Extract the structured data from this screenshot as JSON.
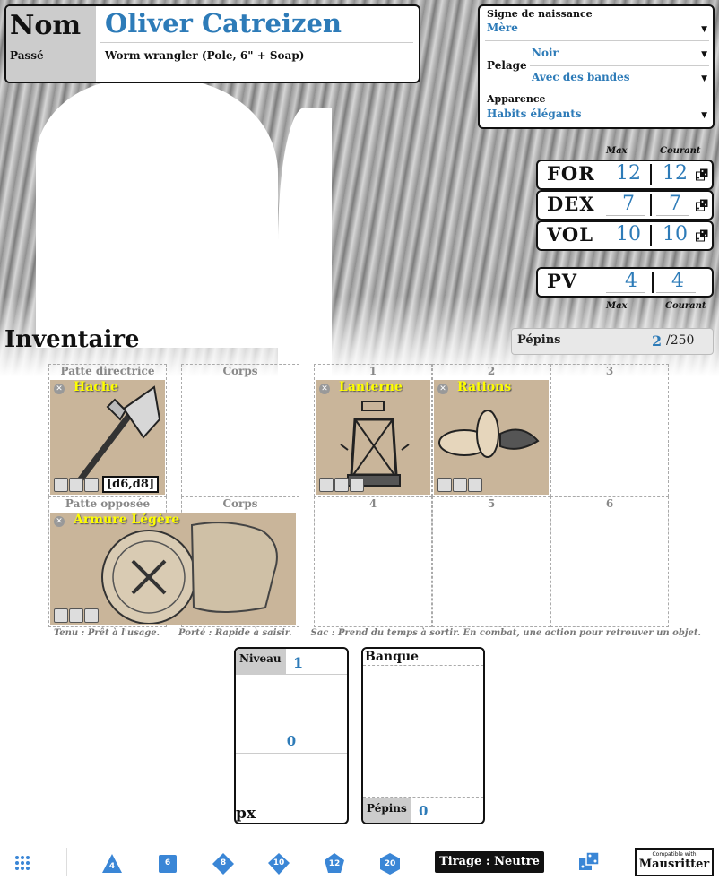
{
  "identity": {
    "name_label": "Nom",
    "name_value": "Oliver Catreizen",
    "background_label": "Passé",
    "background_value": "Worm wrangler (Pole, 6\" + Soap)"
  },
  "traits": {
    "birthsign_label": "Signe de naissance",
    "birthsign_value": "Mère",
    "coat_label": "Pelage",
    "coat_color": "Noir",
    "coat_pattern": "Avec des bandes",
    "look_label": "Apparence",
    "look_value": "Habits élégants"
  },
  "stats": {
    "max_label": "Max",
    "current_label": "Courant",
    "rows": [
      {
        "name": "FOR",
        "max": "12",
        "current": "12"
      },
      {
        "name": "DEX",
        "max": "7",
        "current": "7"
      },
      {
        "name": "VOL",
        "max": "10",
        "current": "10"
      }
    ],
    "hp": {
      "name": "PV",
      "max": "4",
      "current": "4"
    },
    "hp_max_label": "Max",
    "hp_current_label": "Courant"
  },
  "inventory": {
    "title": "Inventaire",
    "pips_label": "Pépins",
    "pips_value": "2",
    "pips_max": "/250",
    "slots": {
      "main_paw": "Patte directrice",
      "body": "Corps",
      "off_paw": "Patte opposée",
      "body2": "Corps",
      "s1": "1",
      "s2": "2",
      "s3": "3",
      "s4": "4",
      "s5": "5",
      "s6": "6"
    },
    "items": {
      "axe": {
        "name": "Hache",
        "damage": "[d6,d8]"
      },
      "lantern": {
        "name": "Lanterne"
      },
      "rations": {
        "name": "Rations"
      },
      "armor": {
        "name": "Armure Légère"
      }
    },
    "legend": "Tenu : Prêt à l'usage.      Porté : Rapide à saisir.      Sac : Prend du temps à sortir. En combat, une action pour retrouver un objet."
  },
  "level": {
    "label": "Niveau",
    "value": "1",
    "xp_value": "0",
    "xp_label": "px"
  },
  "bank": {
    "label": "Banque",
    "pips_label": "Pépins",
    "pips_value": "0"
  },
  "footer": {
    "dice": [
      "4",
      "6",
      "8",
      "10",
      "12",
      "20"
    ],
    "roll_mode": "Tirage : Neutre",
    "compat_top": "Compatible with",
    "compat_brand": "Mausritter"
  },
  "colors": {
    "accent": "#2d7bb8",
    "item_name": "#ffff00"
  }
}
